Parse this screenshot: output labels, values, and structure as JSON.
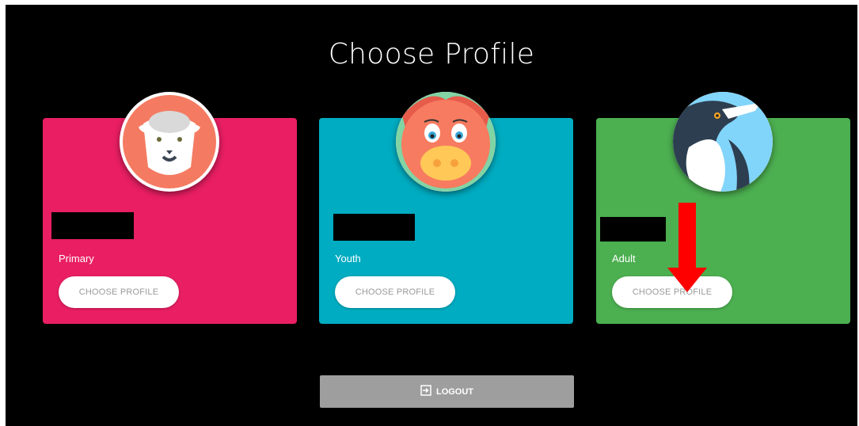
{
  "page": {
    "title": "Choose Profile"
  },
  "colors": {
    "primary": "#e91e63",
    "youth": "#00acc1",
    "adult": "#4caf50",
    "logout": "#9e9e9e",
    "annotation_arrow": "#ff0000"
  },
  "profiles": [
    {
      "tier": "Primary",
      "button": "CHOOSE PROFILE",
      "avatar_icon": "sheep-icon"
    },
    {
      "tier": "Youth",
      "button": "CHOOSE PROFILE",
      "avatar_icon": "pig-icon"
    },
    {
      "tier": "Adult",
      "button": "CHOOSE PROFILE",
      "avatar_icon": "penguin-icon"
    }
  ],
  "logout": {
    "label": "LOGOUT",
    "icon": "logout-icon"
  }
}
